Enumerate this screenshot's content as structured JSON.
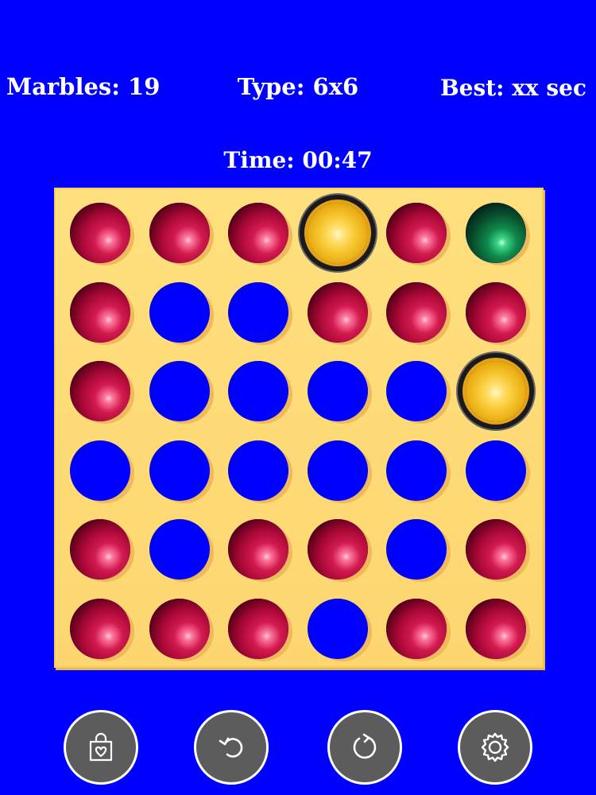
{
  "hud": {
    "marbles": "Marbles: 19",
    "type": "Type: 6x6",
    "best": "Best: xx sec",
    "time": "Time: 00:47"
  },
  "board": {
    "size": 6,
    "cells": [
      [
        "red",
        "red",
        "red",
        "yellow",
        "red",
        "green"
      ],
      [
        "red",
        "empty",
        "empty",
        "red",
        "red",
        "red"
      ],
      [
        "red",
        "empty",
        "empty",
        "empty",
        "empty",
        "yellow"
      ],
      [
        "empty",
        "empty",
        "empty",
        "empty",
        "empty",
        "empty"
      ],
      [
        "red",
        "empty",
        "red",
        "red",
        "empty",
        "red"
      ],
      [
        "red",
        "red",
        "red",
        "empty",
        "red",
        "red"
      ]
    ],
    "selected": [
      [
        0,
        3
      ],
      [
        2,
        5
      ]
    ]
  },
  "colors": {
    "background": "#0000ff",
    "board": "#fdd670",
    "button": "#5c5c5c"
  },
  "toolbar": [
    {
      "name": "shop-button",
      "icon": "shopping-bag-heart-icon"
    },
    {
      "name": "undo-button",
      "icon": "undo-arrow-icon"
    },
    {
      "name": "restart-button",
      "icon": "restart-circle-arrow-icon"
    },
    {
      "name": "settings-button",
      "icon": "gear-icon"
    }
  ]
}
